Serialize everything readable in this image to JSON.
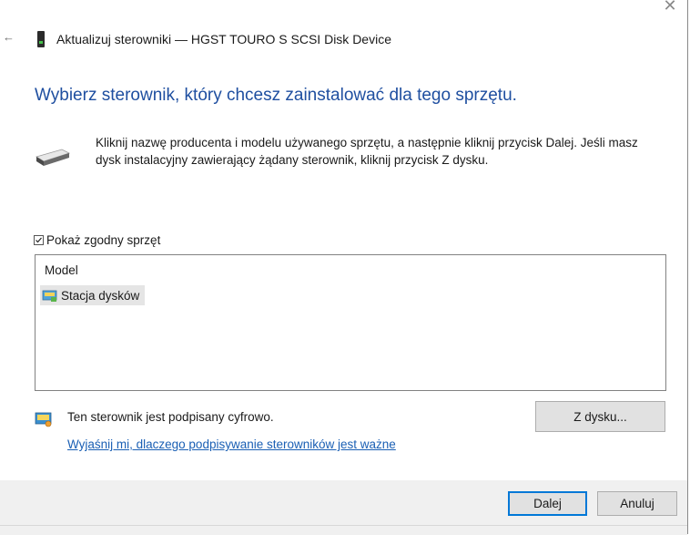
{
  "window": {
    "close_glyph": "✕",
    "back_glyph": "←",
    "title": "Aktualizuj sterowniki — HGST TOURO S SCSI Disk Device"
  },
  "heading": "Wybierz sterownik, który chcesz zainstalować dla tego sprzętu.",
  "instructions": "Kliknij nazwę producenta i modelu używanego sprzętu, a następnie kliknij przycisk Dalej. Jeśli masz dysk instalacyjny zawierający żądany sterownik, kliknij przycisk Z dysku.",
  "compatible_hardware": {
    "label": "Pokaż zgodny sprzęt",
    "checked": true
  },
  "model_list": {
    "header": "Model",
    "items": [
      {
        "label": "Stacja dysków",
        "icon": "disk-drive-icon",
        "selected": true
      }
    ]
  },
  "signature": {
    "text": "Ten sterownik jest podpisany cyfrowo.",
    "icon": "signed-driver-icon",
    "link": "Wyjaśnij mi, dlaczego podpisywanie sterowników jest ważne"
  },
  "buttons": {
    "have_disk": "Z dysku...",
    "next": "Dalej",
    "cancel": "Anuluj"
  },
  "colors": {
    "heading": "#1f4fa0",
    "link": "#1a5fb4",
    "accent": "#0078d7"
  }
}
